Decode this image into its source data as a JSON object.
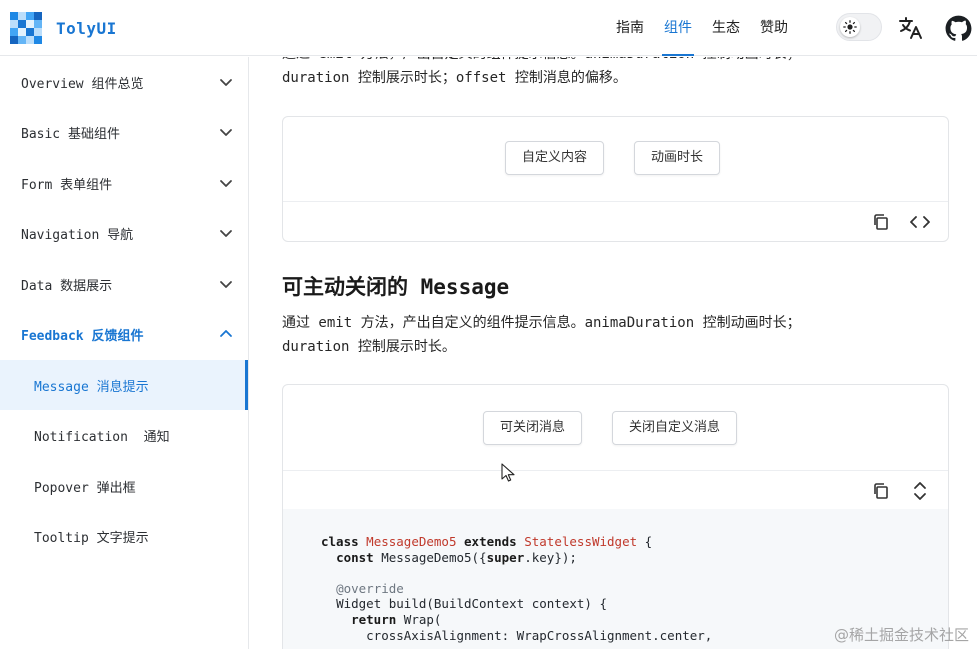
{
  "header": {
    "brand": "TolyUI",
    "nav": [
      {
        "label": "指南",
        "active": false
      },
      {
        "label": "组件",
        "active": true
      },
      {
        "label": "生态",
        "active": false
      },
      {
        "label": "赞助",
        "active": false
      }
    ],
    "icons": [
      "sun-icon",
      "translate-icon",
      "github-icon"
    ]
  },
  "sidebar": {
    "items": [
      {
        "label": "Overview 组件总览",
        "type": "group"
      },
      {
        "label": "Basic 基础组件",
        "type": "group"
      },
      {
        "label": "Form 表单组件",
        "type": "group"
      },
      {
        "label": "Navigation 导航",
        "type": "group"
      },
      {
        "label": "Data 数据展示",
        "type": "group"
      },
      {
        "label": "Feedback 反馈组件",
        "type": "group-open"
      },
      {
        "label": "Message 消息提示",
        "type": "child-selected"
      },
      {
        "label": "Notification  通知",
        "type": "child"
      },
      {
        "label": "Popover 弹出框",
        "type": "child"
      },
      {
        "label": "Tooltip 文字提示",
        "type": "child"
      }
    ]
  },
  "content": {
    "intro_line1": "通过 emit 方法，产出自定义的组件提示信息。animaDuration 控制动画时长；",
    "intro_line2": "duration 控制展示时长；offset 控制消息的偏移。",
    "demo1": {
      "buttons": [
        "自定义内容",
        "动画时长"
      ]
    },
    "section_title": "可主动关闭的 Message",
    "desc_line1": "通过 emit 方法，产出自定义的组件提示信息。animaDuration 控制动画时长；",
    "desc_line2": "duration 控制展示时长。",
    "demo2": {
      "buttons": [
        "可关闭消息",
        "关闭自定义消息"
      ]
    },
    "code": {
      "l1_kw": "class",
      "l1_cls": "MessageDemo5",
      "l1_kw2": "extends",
      "l1_cls2": "StatelessWidget",
      "l1_rest": " {",
      "l2_kw": "const",
      "l2_a": " MessageDemo5({",
      "l2_kw2": "super",
      "l2_b": ".key});",
      "l3": "@override",
      "l4": "Widget build(BuildContext context) {",
      "l5_kw": "return",
      "l5_rest": " Wrap(",
      "l6": "crossAxisAlignment: WrapCrossAlignment.center,"
    }
  },
  "watermark": "@稀土掘金技术社区",
  "colors": {
    "accent": "#1976d2",
    "code_class": "#c0392b",
    "selected_bg": "#eaf3fd"
  }
}
